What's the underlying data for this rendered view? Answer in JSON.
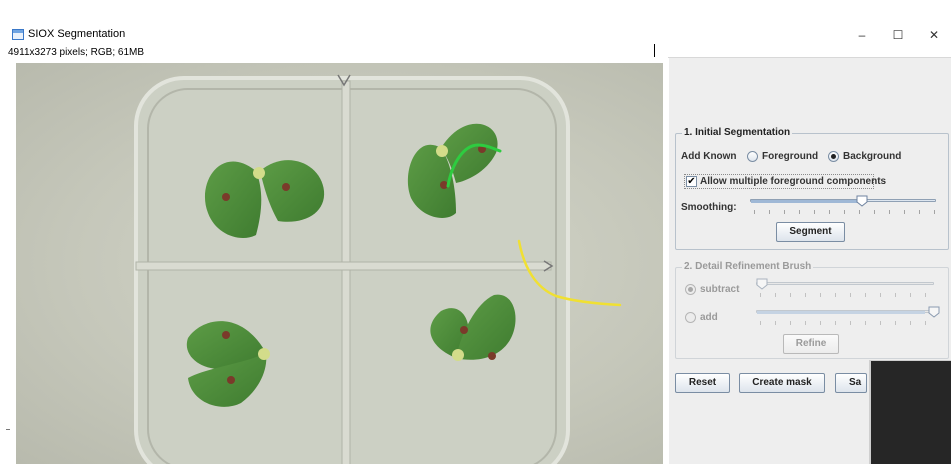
{
  "window": {
    "title": "SIOX Segmentation",
    "controls": {
      "minimize": "–",
      "maximize": "☐",
      "close": "✕"
    }
  },
  "image_info": "4911x3273 pixels; RGB; 61MB",
  "panel": {
    "initial_segmentation": {
      "legend": "1. Initial Segmentation",
      "add_known_label": "Add Known",
      "foreground_label": "Foreground",
      "background_label": "Background",
      "selected_option": "Background",
      "allow_multiple_label": "Allow multiple foreground components",
      "allow_multiple_checked": true,
      "smoothing_label": "Smoothing:",
      "smoothing_level": 0.6,
      "segment_button": "Segment"
    },
    "refinement": {
      "legend": "2. Detail Refinement Brush",
      "subtract_label": "subtract",
      "add_label": "add",
      "selected_option": "subtract",
      "subtract_level": 0.0,
      "add_level": 1.0,
      "refine_button": "Refine"
    },
    "bottom_buttons": {
      "reset": "Reset",
      "create_mask": "Create mask",
      "save": "Sa"
    }
  },
  "icons": {
    "app": "siox-app-icon",
    "check": "✔"
  },
  "colors": {
    "leaf": "#4f8f3c",
    "spot": "#7a3a2a",
    "background_stroke": "#f0e032",
    "foreground_stroke": "#2ecc40"
  }
}
